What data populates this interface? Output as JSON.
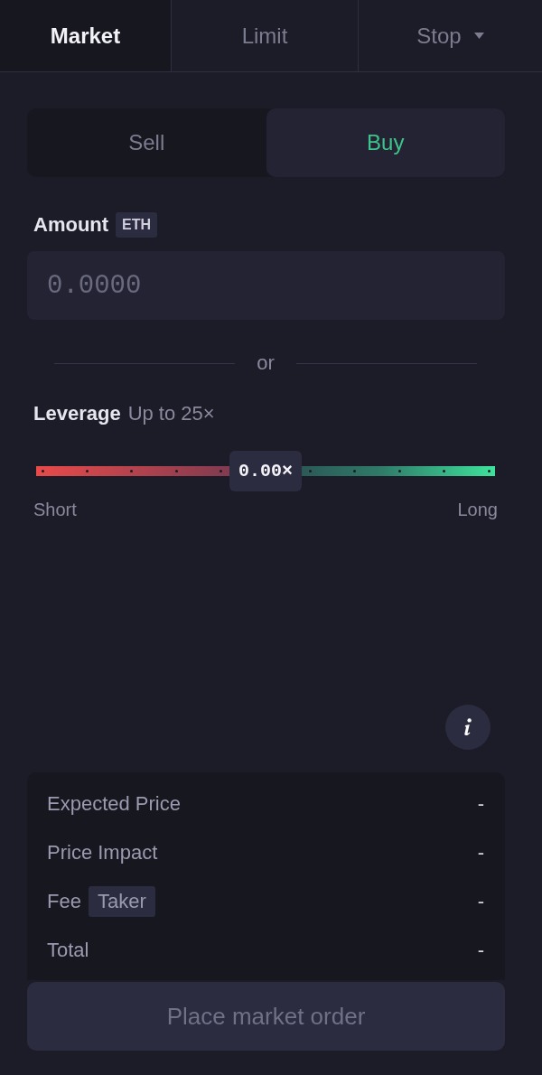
{
  "order_tabs": [
    {
      "label": "Market",
      "selected": true,
      "kind": "plain"
    },
    {
      "label": "Limit",
      "selected": false,
      "kind": "plain"
    },
    {
      "label": "Stop",
      "selected": false,
      "kind": "dropdown"
    }
  ],
  "side_toggle": [
    {
      "label": "Sell",
      "selected": false,
      "kind": "sell"
    },
    {
      "label": "Buy",
      "selected": true,
      "kind": "buy"
    }
  ],
  "amount": {
    "label": "Amount",
    "unit": "ETH",
    "placeholder": "0.0000"
  },
  "separator": {
    "label": "or"
  },
  "leverage": {
    "label": "Leverage",
    "limit": "Up to 25×",
    "value": "0.00×",
    "level": 0.5,
    "min_label": "Short",
    "max_label": "Long"
  },
  "summary": {
    "rows": [
      {
        "label": "Expected Price",
        "value": "-"
      },
      {
        "label": "Price Impact",
        "value": "-"
      },
      {
        "label": "Fee",
        "tag": "Taker",
        "value": "-"
      },
      {
        "label": "Total",
        "value": "-"
      }
    ]
  },
  "submit": {
    "label": "Place market order",
    "disabled": true
  }
}
